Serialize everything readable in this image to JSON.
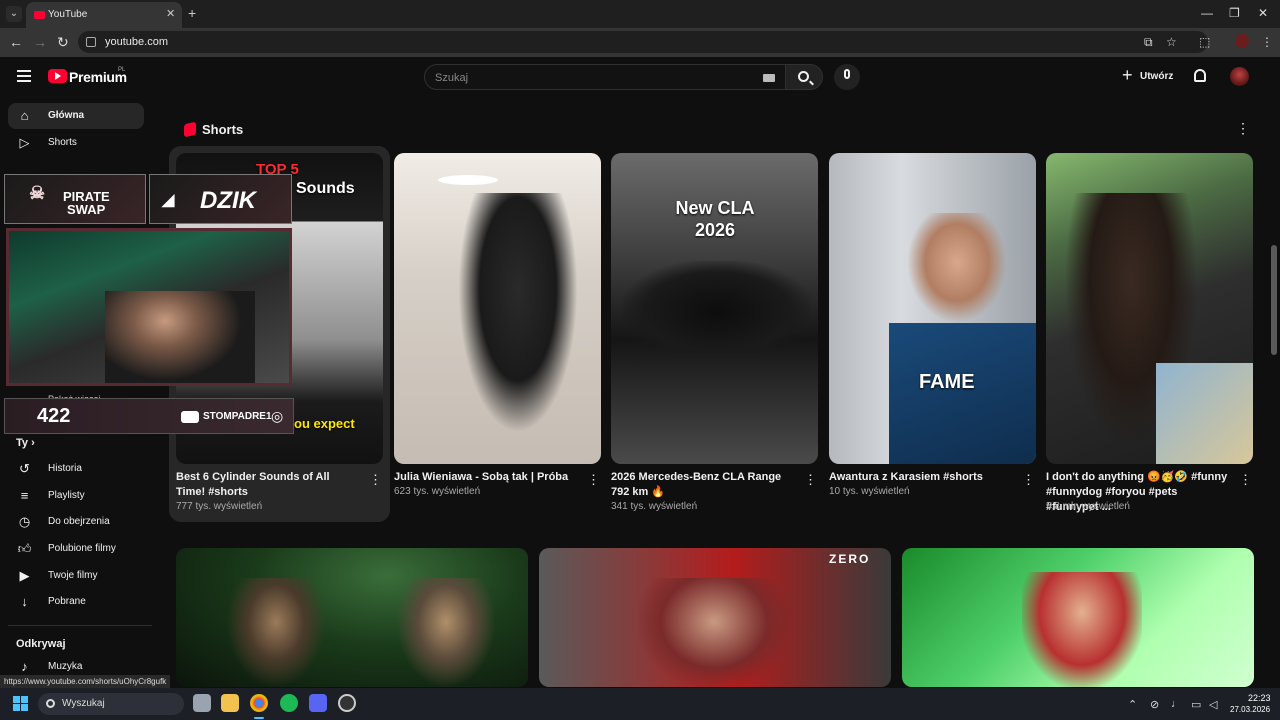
{
  "browser": {
    "tab_title": "YouTube",
    "url": "youtube.com",
    "status_url": "https://www.youtube.com/shorts/uOhyCr8gufk"
  },
  "youtube": {
    "brand": "Premium",
    "region": "PL",
    "search_placeholder": "Szukaj",
    "create_label": "Utwórz"
  },
  "sidebar": {
    "top": [
      {
        "label": "Główna",
        "icon": "home-icon",
        "active": true
      },
      {
        "label": "Shorts",
        "icon": "shorts-icon",
        "active": false
      }
    ],
    "you_heading": "Ty",
    "you_items": [
      {
        "label": "Historia",
        "icon": "history-icon"
      },
      {
        "label": "Playlisty",
        "icon": "playlist-icon"
      },
      {
        "label": "Do obejrzenia",
        "icon": "watch-later-icon"
      },
      {
        "label": "Polubione filmy",
        "icon": "like-icon"
      },
      {
        "label": "Twoje filmy",
        "icon": "your-videos-icon"
      },
      {
        "label": "Pobrane",
        "icon": "download-icon"
      }
    ],
    "explore_heading": "Odkrywaj",
    "explore_items": [
      {
        "label": "Muzyka",
        "icon": "music-icon"
      }
    ],
    "show_more": "Pokaż więcej"
  },
  "overlay": {
    "sponsor_a": "PIRATE SWAP",
    "sponsor_a_line1": "PIRATE",
    "sponsor_a_line2": "SWAP",
    "sponsor_b": "DZIK",
    "sub_count": "422",
    "handle": "STOMPADRE1"
  },
  "shorts": {
    "heading": "Shorts",
    "items": [
      {
        "title": "Best 6 Cylinder Sounds of All Time! #shorts",
        "views": "777 tys. wyświetleń",
        "thumb_top": "TOP 5",
        "thumb_mid": "Sounds",
        "thumb_bottom": "ou expect"
      },
      {
        "title": "Julia Wieniawa - Sobą tak | Próba",
        "views": "623 tys. wyświetleń"
      },
      {
        "title": "2026 Mercedes-Benz CLA Range 792 km 🔥",
        "views": "341 tys. wyświetleń",
        "thumb_text": "New CLA 2026"
      },
      {
        "title": "Awantura z Karasiem #shorts",
        "views": "10 tys. wyświetleń",
        "thumb_text": "FAME"
      },
      {
        "title": "I don't do anything 😡🥳🤣 #funny #funnydog #foryou #pets #funnypet ...",
        "views": "5,8 mln wyświetleń"
      }
    ]
  },
  "videos": {
    "zero_badge": "ZERO"
  },
  "taskbar": {
    "search_label": "Wyszukaj",
    "time": "22:23",
    "date": "27.03.2026"
  }
}
